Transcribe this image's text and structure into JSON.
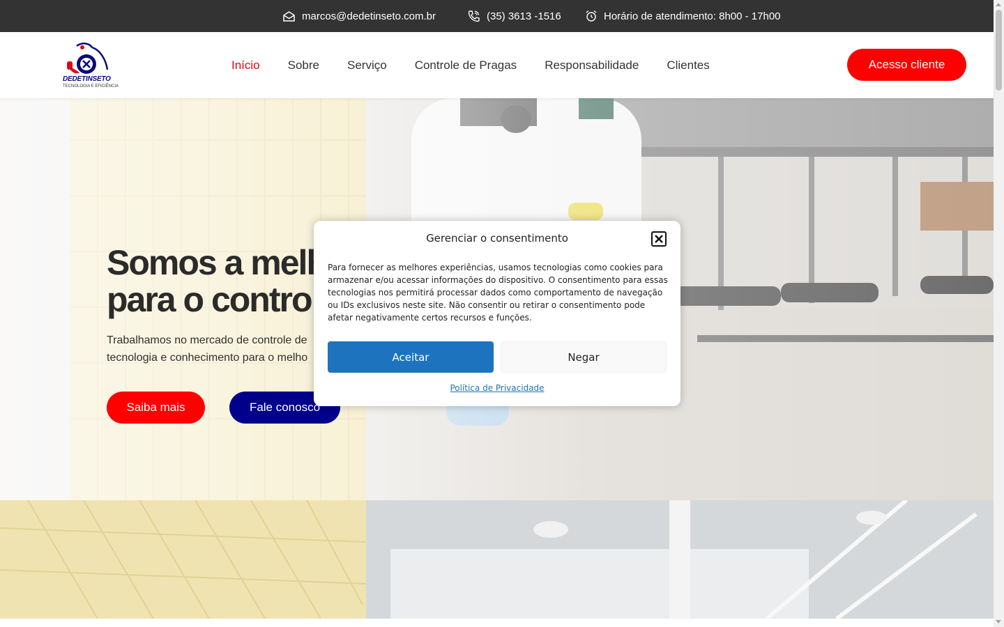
{
  "topbar": {
    "email": "marcos@dedetinseto.com.br",
    "phone": "(35) 3613 -1516",
    "hours": "Horário de atendimento: 8h00 - 17h00",
    "icons": [
      "envelope-icon",
      "phone-icon",
      "alarm-clock-icon"
    ]
  },
  "header": {
    "logo_text": "DEDETINSETO",
    "logo_subtext": "TECNOLOGIA E EFICIÊNCIA",
    "nav": [
      {
        "label": "Início",
        "active": true
      },
      {
        "label": "Sobre",
        "active": false
      },
      {
        "label": "Serviço",
        "active": false
      },
      {
        "label": "Controle de Pragas",
        "active": false
      },
      {
        "label": "Responsabilidade",
        "active": false
      },
      {
        "label": "Clientes",
        "active": false
      }
    ],
    "client_button": "Acesso cliente"
  },
  "hero": {
    "headline_line1": "Somos a melh",
    "headline_line2": "para o control",
    "text_line1": "Trabalhamos no mercado de controle de",
    "text_line2": "tecnologia e conhecimento para o melho",
    "button_more": "Saiba mais",
    "button_contact": "Fale conosco"
  },
  "consent": {
    "title": "Gerenciar o consentimento",
    "body": "Para fornecer as melhores experiências, usamos tecnologias como cookies para armazenar e/ou acessar informações do dispositivo. O consentimento para essas tecnologias nos permitirá processar dados como comportamento de navegação ou IDs exclusivos neste site. Não consentir ou retirar o consentimento pode afetar negativamente certos recursos e funções.",
    "accept": "Aceitar",
    "deny": "Negar",
    "policy_link": "Política de Privacidade"
  },
  "colors": {
    "accent_red": "#ff0000",
    "nav_active": "#e30613",
    "navy": "#00008b",
    "accept_blue": "#1e73be",
    "topbar_bg": "#333333"
  }
}
